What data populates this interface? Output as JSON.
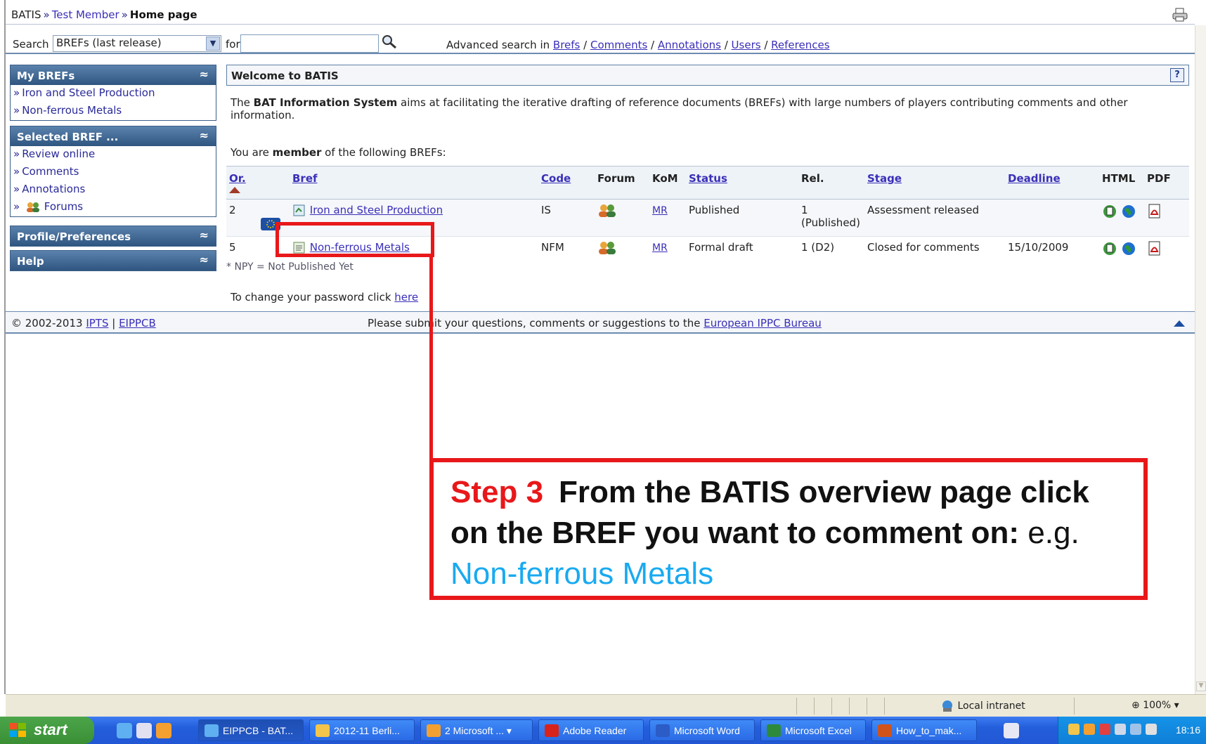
{
  "breadcrumb": [
    "BATIS",
    "Test Member",
    "Home page"
  ],
  "search": {
    "label": "Search",
    "selected": "BREFs (last release)",
    "for_label": "for",
    "value": "",
    "advanced_prefix": "Advanced search in",
    "advanced_links": [
      "Brefs",
      "Comments",
      "Annotations",
      "Users",
      "References"
    ]
  },
  "sidebar": {
    "my_brefs": {
      "title": "My BREFs",
      "items": [
        "Iron and Steel Production",
        "Non-ferrous Metals"
      ]
    },
    "selected_bref": {
      "title": "Selected BREF ...",
      "items": [
        "Review online",
        "Comments",
        "Annotations",
        "Forums"
      ]
    },
    "profile": {
      "title": "Profile/Preferences"
    },
    "help": {
      "title": "Help"
    }
  },
  "main": {
    "title": "Welcome to BATIS",
    "intro_pre": "The ",
    "intro_bold": "BAT Information System",
    "intro_post": " aims at facilitating the iterative drafting of reference documents (BREFs) with large numbers of players contributing comments and other information.",
    "member_pre": "You are ",
    "member_bold": "member",
    "member_post": " of the following BREFs:",
    "columns": [
      "Or.",
      "Bref",
      "Code",
      "Forum",
      "KoM",
      "Status",
      "Rel.",
      "Stage",
      "Deadline",
      "HTML",
      "PDF"
    ],
    "rows": [
      {
        "or": "2",
        "bref": "Iron and Steel Production",
        "code": "IS",
        "kom": "MR",
        "status": "Published",
        "rel": "1 (Published)",
        "stage": "Assessment released",
        "deadline": ""
      },
      {
        "or": "5",
        "bref": "Non-ferrous Metals",
        "code": "NFM",
        "kom": "MR",
        "status": "Formal draft",
        "rel": "1 (D2)",
        "stage": "Closed for comments",
        "deadline": "15/10/2009"
      }
    ],
    "npy_note": "* NPY = Not Published Yet",
    "password_pre": "To change your password click ",
    "password_link": "here"
  },
  "footer": {
    "copyright": "© 2002-2013",
    "links": [
      "IPTS",
      "EIPPCB"
    ],
    "message_pre": "Please submit your questions, comments or suggestions to the ",
    "message_link": "European IPPC Bureau"
  },
  "annotation": {
    "step": "Step 3",
    "text": "From the BATIS overview page click on the BREF you want to comment on:",
    "eg": "e.g.",
    "bref_name": "Non-ferrous Metals",
    "color": "#e8181a",
    "bref_color": "#19aaf0"
  },
  "statusbar": {
    "zone": "Local intranet",
    "zoom": "100%"
  },
  "taskbar": {
    "start": "start",
    "buttons": [
      "EIPPCB - BAT...",
      "2012-11 Berli...",
      "2 Microsoft ...",
      "Adobe Reader",
      "Microsoft Word",
      "Microsoft Excel",
      "How_to_mak..."
    ],
    "clock": "18:16"
  }
}
